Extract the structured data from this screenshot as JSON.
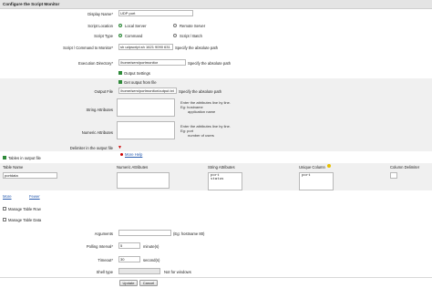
{
  "header": {
    "title": "Configure the Script Monitor"
  },
  "display_name": {
    "label": "Display Name",
    "value": "UDP port"
  },
  "script_location": {
    "label": "Script Location",
    "options": [
      "Local Server",
      "Remote Server"
    ],
    "selected": "Local Server"
  },
  "script_type": {
    "label": "Script Type",
    "options": [
      "Command",
      "Script / Batch"
    ],
    "selected": "Command"
  },
  "script_command": {
    "label": "Script / Command to Monitor",
    "value": "sh udpscript.sh 1621 9090 631",
    "hint": "Specify the absolute path"
  },
  "exec_dir": {
    "label": "Execution Directory",
    "value": "/home/sem/portmonitor",
    "hint": "Specify the absolute path"
  },
  "output_settings": {
    "label": "Output Settings",
    "checked": true
  },
  "get_output": {
    "label": "Get output from file",
    "checked": true
  },
  "output_file": {
    "label": "Output File",
    "value": "/home/sem/portmonitor/output.txt",
    "hint": "Specify the absolute path"
  },
  "string_attributes": {
    "label": "String Attributes",
    "value": "",
    "hint_line1": "Enter the attributes line by line.",
    "hint_line2": "Eg: hostname",
    "hint_line3": "application name"
  },
  "numeric_attributes": {
    "label": "Numeric Attributes",
    "value": "",
    "hint_line1": "Enter the attributes line by line.",
    "hint_line2": "Eg: port",
    "hint_line3": "number of users"
  },
  "delimiter": {
    "label": "Delimiter in the output file",
    "more_help": "More Help"
  },
  "tables": {
    "checkbox_label": "Tables in output file",
    "checked": true,
    "columns": [
      "Table Name",
      "Numeric Attributes",
      "String Attributes",
      "Unique Column",
      "Column Delimiter"
    ],
    "row": {
      "table_name": "portdata",
      "numeric": "",
      "string": "port\nstatus",
      "unique": "port",
      "delimiter": ""
    },
    "more_link": "More",
    "fewer_link": "Fewer"
  },
  "manage_row": {
    "label": "Manage Table Row",
    "checked": false
  },
  "manage_data": {
    "label": "Manage Table Data",
    "checked": false
  },
  "arguments": {
    "label": "Arguments",
    "value": "",
    "hint": "(Eg: hostname 80)"
  },
  "polling": {
    "label": "Polling Interval",
    "value": "5",
    "unit": "minute(s)"
  },
  "timeout": {
    "label": "Timeout",
    "value": "30",
    "unit": "second(s)"
  },
  "shell": {
    "label": "Shell type",
    "value": "",
    "hint": "Not for windows"
  },
  "buttons": {
    "update": "Update",
    "cancel": "Cancel"
  },
  "colors": {
    "accent_green": "#2f8a3a",
    "required_red": "#cc0000",
    "help_yellow": "#e8c000"
  }
}
